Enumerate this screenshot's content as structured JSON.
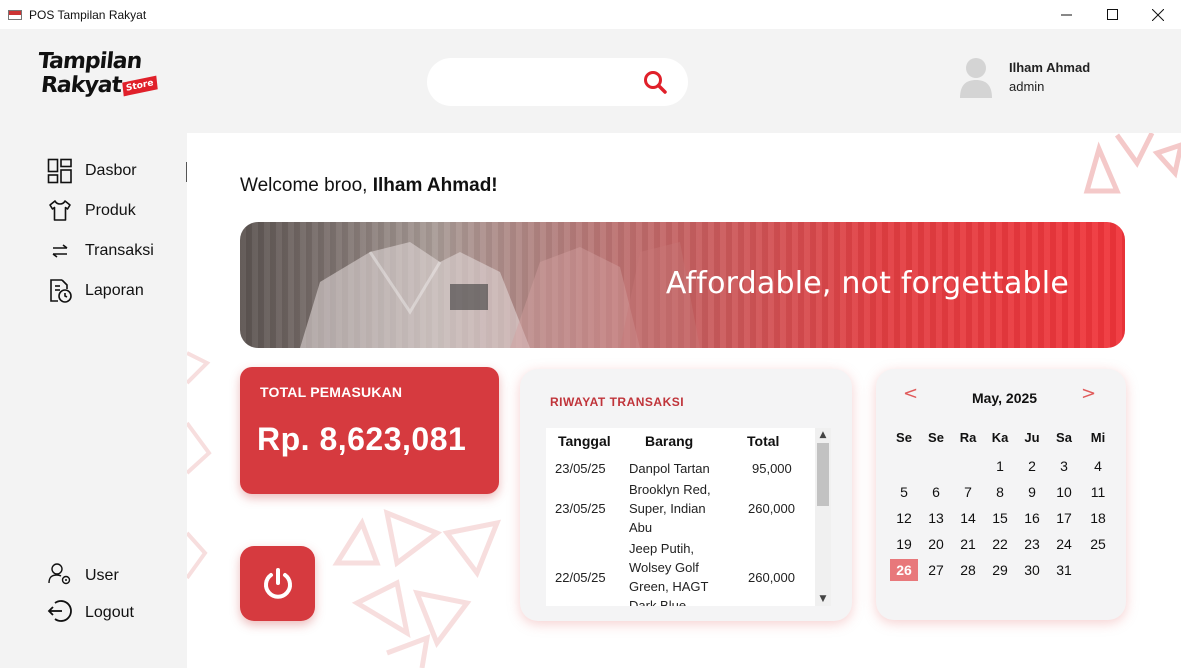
{
  "window": {
    "title": "POS Tampilan Rakyat",
    "minimize": "—",
    "maximize": "☐",
    "close": "✕"
  },
  "logo": {
    "line1": "Tampilan",
    "line2": "Rakyat",
    "badge": "Store"
  },
  "search": {
    "value": "",
    "placeholder": ""
  },
  "user": {
    "name": "Ilham Ahmad",
    "role": "admin"
  },
  "sidebar": {
    "items": [
      {
        "label": "Dasbor",
        "icon": "dashboard-icon"
      },
      {
        "label": "Produk",
        "icon": "shirt-icon"
      },
      {
        "label": "Transaksi",
        "icon": "swap-icon"
      },
      {
        "label": "Laporan",
        "icon": "report-icon"
      }
    ],
    "bottom": [
      {
        "label": "User",
        "icon": "user-settings-icon"
      },
      {
        "label": "Logout",
        "icon": "logout-icon"
      }
    ]
  },
  "welcome": {
    "prefix": "Welcome broo,",
    "name": "Ilham Ahmad!"
  },
  "banner": {
    "text": "Affordable, not forgettable"
  },
  "income": {
    "title": "TOTAL PEMASUKAN",
    "value": "Rp. 8,623,081"
  },
  "transactions": {
    "title": "RIWAYAT TRANSAKSI",
    "columns": [
      "Tanggal",
      "Barang",
      "Total"
    ],
    "rows": [
      {
        "date": "23/05/25",
        "items": "Danpol Tartan",
        "total": "95,000"
      },
      {
        "date": "23/05/25",
        "items": "Brooklyn Red, Super, Indian Abu",
        "total": "260,000"
      },
      {
        "date": "22/05/25",
        "items": "Jeep Putih, Wolsey Golf Green, HAGT Dark Blue",
        "total": "260,000"
      }
    ],
    "scroll_up": "▲",
    "scroll_down": "▼"
  },
  "calendar": {
    "prev": "<",
    "next": ">",
    "month": "May, 2025",
    "weekdays": [
      "Se",
      "Se",
      "Ra",
      "Ka",
      "Ju",
      "Sa",
      "Mi"
    ],
    "weeks": [
      [
        "",
        "",
        "",
        "1",
        "2",
        "3",
        "4"
      ],
      [
        "5",
        "6",
        "7",
        "8",
        "9",
        "10",
        "11"
      ],
      [
        "12",
        "13",
        "14",
        "15",
        "16",
        "17",
        "18"
      ],
      [
        "19",
        "20",
        "21",
        "22",
        "23",
        "24",
        "25"
      ],
      [
        "26",
        "27",
        "28",
        "29",
        "30",
        "31",
        ""
      ]
    ],
    "today": "26"
  },
  "colors": {
    "accent": "#d63a3f",
    "today": "#e8787b",
    "sidebar_bg": "#f3f3f3"
  }
}
